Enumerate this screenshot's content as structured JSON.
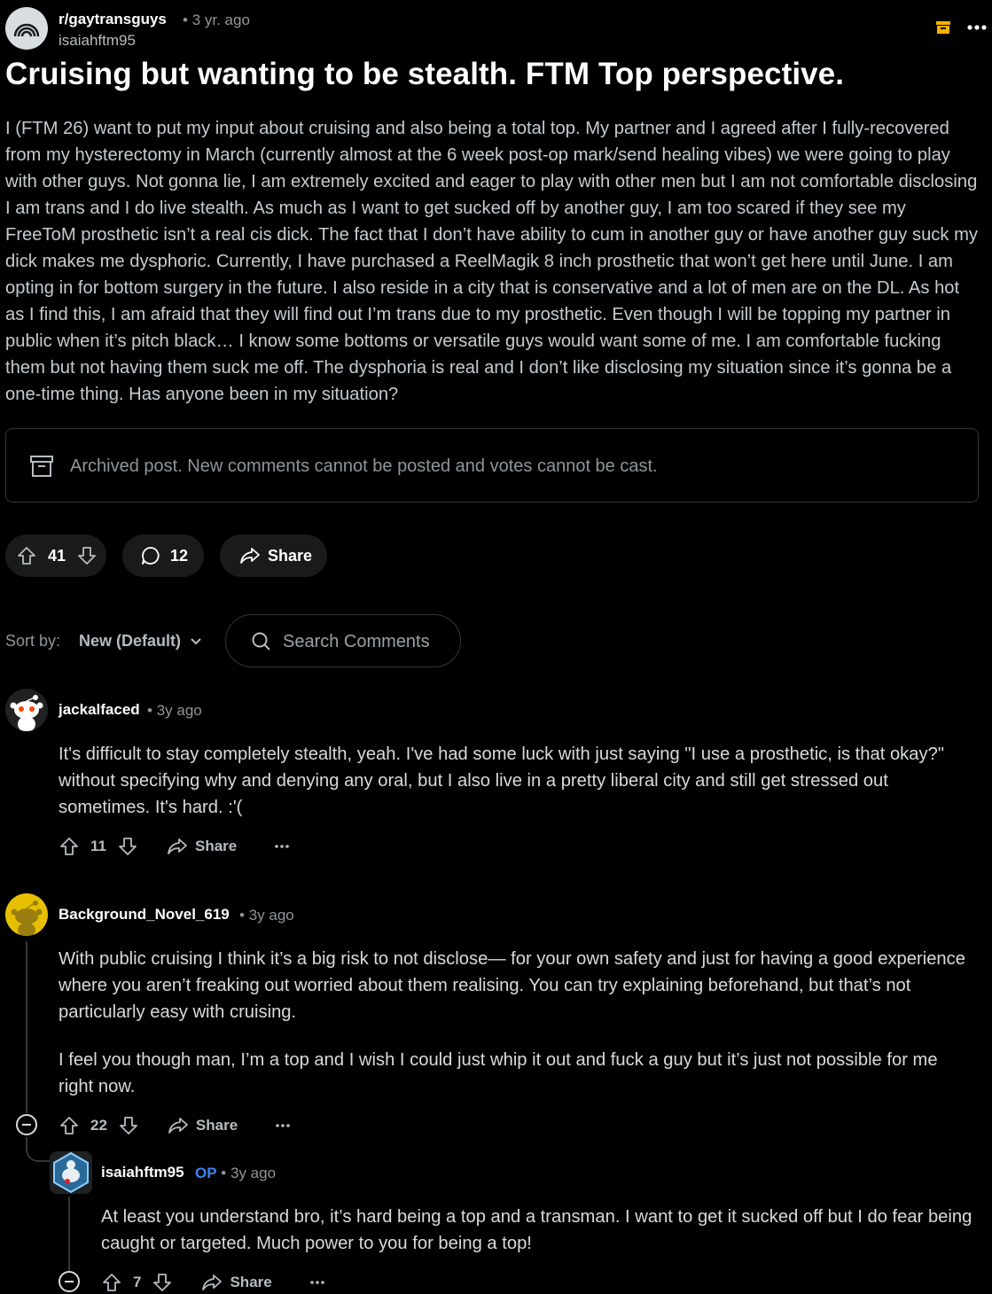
{
  "post": {
    "subreddit": "r/gaytransguys",
    "age": "3 yr. ago",
    "author": "isaiahftm95",
    "title": "Cruising but wanting to be stealth. FTM Top perspective.",
    "body": "I (FTM 26) want to put my input about cruising and also being a total top. My partner and I agreed after I fully-recovered from my hysterectomy in March (currently almost at the 6 week post-op mark/send healing vibes) we were going to play with other guys. Not gonna lie, I am extremely excited and eager to play with other men but I am not comfortable disclosing I am trans and I do live stealth. As much as I want to get sucked off by another guy, I am too scared if they see my FreeToM prosthetic isn’t a real cis dick. The fact that I don’t have ability to cum in another guy or have another guy suck my dick makes me dysphoric. Currently, I have purchased a ReelMagik 8 inch prosthetic that won’t get here until June. I am opting in for bottom surgery in the future. I also reside in a city that is conservative and a lot of men are on the DL. As hot as I find this, I am afraid that they will find out I’m trans due to my prosthetic. Even though I will be topping my partner in public when it’s pitch black… I know some bottoms or versatile guys would want some of me. I am comfortable fucking them but not having them suck me off. The dysphoria is real and I don’t like disclosing my situation since it’s gonna be a one-time thing. Has anyone been in my situation?",
    "archived_notice": "Archived post. New comments cannot be posted and votes cannot be cast.",
    "votes": "41",
    "comments": "12",
    "share_label": "Share"
  },
  "sort": {
    "label": "Sort by:",
    "value": "New (Default)",
    "search_placeholder": "Search Comments"
  },
  "comments": [
    {
      "user": "jackalfaced",
      "age": "3y ago",
      "text": "It's difficult to stay completely stealth, yeah. I've had some luck with just saying \"I use a prosthetic, is that okay?\" without specifying why and denying any oral, but I also live in a pretty liberal city and still get stressed out sometimes. It's hard. :'(",
      "votes": "11",
      "share": "Share"
    },
    {
      "user": "Background_Novel_619",
      "age": "3y ago",
      "text1": "With public cruising I think it’s a big risk to not disclose— for your own safety and just for having a good experience where you aren’t freaking out worried about them realising. You can try explaining beforehand, but that’s not particularly easy with cruising.",
      "text2": "I feel you though man, I’m a top and I wish I could just whip it out and fuck a guy but it’s just not possible for me right now.",
      "votes": "22",
      "share": "Share"
    },
    {
      "user": "isaiahftm95",
      "op": "OP",
      "age": "3y ago",
      "text": "At least you understand bro, it’s hard being a top and a transman. I want to get it sucked off but I do fear being caught or targeted. Much power to you for being a top!",
      "votes": "7",
      "share": "Share"
    }
  ],
  "colors": {
    "background": "#000000",
    "pill": "#1a1a1b",
    "op_badge": "#3b82f6",
    "archive_icon": "#f5b300"
  }
}
